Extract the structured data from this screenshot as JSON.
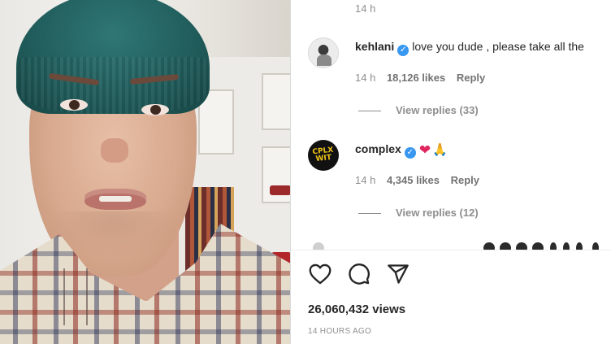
{
  "post": {
    "media_alt": "video",
    "views": "26,060,432 views",
    "posted": "14 HOURS AGO"
  },
  "comments": {
    "top_partial": {
      "time": "14 h"
    },
    "items": [
      {
        "username": "kehlani",
        "verified": true,
        "text": "love you dude , please take all the",
        "time": "14 h",
        "likes": "18,126 likes",
        "reply": "Reply",
        "view_replies": "View replies (33)",
        "avatar_icon": "profile-photo"
      },
      {
        "username": "complex",
        "verified": true,
        "text": "",
        "emoji": [
          "red-heart",
          "folded-hands"
        ],
        "time": "14 h",
        "likes": "4,345 likes",
        "reply": "Reply",
        "view_replies": "View replies (12)",
        "avatar_icon": "complex-logo"
      }
    ]
  },
  "actions": {
    "like_icon": "heart-icon",
    "comment_icon": "comment-icon",
    "share_icon": "share-icon"
  },
  "colors": {
    "verified": "#3897f0",
    "muted_text": "#8e8e8e",
    "text": "#262626",
    "heart": "#e0245e"
  }
}
